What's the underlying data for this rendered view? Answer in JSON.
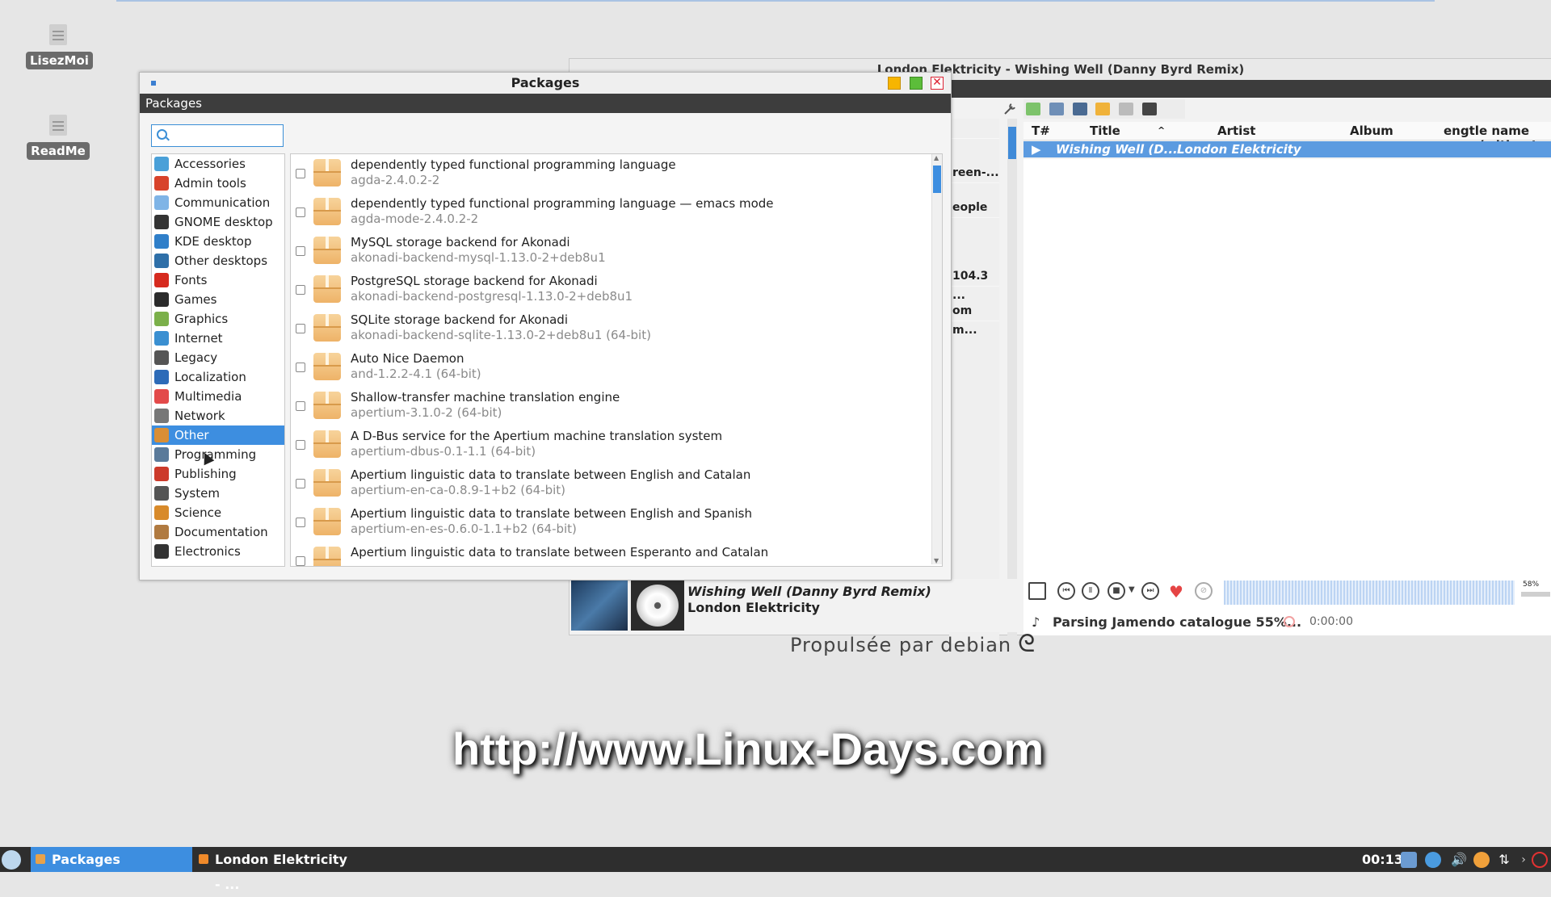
{
  "desktop": {
    "icons": [
      {
        "label": "LisezMoi"
      },
      {
        "label": "ReadMe"
      }
    ],
    "debian_text": "Propulsée par debian",
    "watermark": "http://www.Linux-Days.com"
  },
  "player": {
    "title": "London Elektricity - Wishing Well (Danny Byrd Remix)",
    "side_rows": [
      "",
      "reen-...",
      "eople",
      "",
      "",
      "104.3 ...",
      "om m..."
    ],
    "columns": {
      "track": "T#",
      "title": "Title",
      "artist": "Artist",
      "album": "Album",
      "length": "engtl",
      "filename": "e name (without"
    },
    "current_row": {
      "title": "Wishing Well (D...",
      "artist": "London Elektricity"
    },
    "now_playing": {
      "title": "Wishing Well (Danny Byrd Remix)",
      "artist": "London Elektricity"
    },
    "status": "Parsing Jamendo catalogue 55%...",
    "time": "0:00:00",
    "volume": "58%"
  },
  "packages": {
    "title": "Packages",
    "menu_label": "Packages",
    "search": {
      "value": "",
      "placeholder": ""
    },
    "categories": [
      {
        "label": "Accessories",
        "color": "#4aa0d8"
      },
      {
        "label": "Admin tools",
        "color": "#d8432b"
      },
      {
        "label": "Communication",
        "color": "#7fb4e6"
      },
      {
        "label": "GNOME desktop",
        "color": "#333333"
      },
      {
        "label": "KDE desktop",
        "color": "#2f7fc9"
      },
      {
        "label": "Other desktops",
        "color": "#2e6fa8"
      },
      {
        "label": "Fonts",
        "color": "#d62a1e"
      },
      {
        "label": "Games",
        "color": "#2b2b2b"
      },
      {
        "label": "Graphics",
        "color": "#7bb04a"
      },
      {
        "label": "Internet",
        "color": "#3a8fd1"
      },
      {
        "label": "Legacy",
        "color": "#555555"
      },
      {
        "label": "Localization",
        "color": "#2d6bb8"
      },
      {
        "label": "Multimedia",
        "color": "#e34a4a"
      },
      {
        "label": "Network",
        "color": "#777777"
      },
      {
        "label": "Other",
        "color": "#d98e35"
      },
      {
        "label": "Programming",
        "color": "#5a7a9a"
      },
      {
        "label": "Publishing",
        "color": "#cc3a2a"
      },
      {
        "label": "System",
        "color": "#555555"
      },
      {
        "label": "Science",
        "color": "#d88a2a"
      },
      {
        "label": "Documentation",
        "color": "#b07a40"
      },
      {
        "label": "Electronics",
        "color": "#333333"
      }
    ],
    "selected_category": "Other",
    "items": [
      {
        "summary": "dependently typed functional programming language",
        "name": "agda-2.4.0.2-2"
      },
      {
        "summary": "dependently typed functional programming language — emacs mode",
        "name": "agda-mode-2.4.0.2-2"
      },
      {
        "summary": "MySQL storage backend for Akonadi",
        "name": "akonadi-backend-mysql-1.13.0-2+deb8u1"
      },
      {
        "summary": "PostgreSQL storage backend for Akonadi",
        "name": "akonadi-backend-postgresql-1.13.0-2+deb8u1"
      },
      {
        "summary": "SQLite storage backend for Akonadi",
        "name": "akonadi-backend-sqlite-1.13.0-2+deb8u1 (64-bit)"
      },
      {
        "summary": "Auto Nice Daemon",
        "name": "and-1.2.2-4.1 (64-bit)"
      },
      {
        "summary": "Shallow-transfer machine translation engine",
        "name": "apertium-3.1.0-2 (64-bit)"
      },
      {
        "summary": "A D-Bus service for the Apertium machine translation system",
        "name": "apertium-dbus-0.1-1.1 (64-bit)"
      },
      {
        "summary": "Apertium linguistic data to translate between English and Catalan",
        "name": "apertium-en-ca-0.8.9-1+b2 (64-bit)"
      },
      {
        "summary": "Apertium linguistic data to translate between English and Spanish",
        "name": "apertium-en-es-0.6.0-1.1+b2 (64-bit)"
      },
      {
        "summary": "Apertium linguistic data to translate between Esperanto and Catalan",
        "name": ""
      }
    ]
  },
  "taskbar": {
    "tasks": [
      {
        "label": "Packages"
      },
      {
        "label": "London Elektricity - ..."
      }
    ],
    "clock": "00:13"
  }
}
